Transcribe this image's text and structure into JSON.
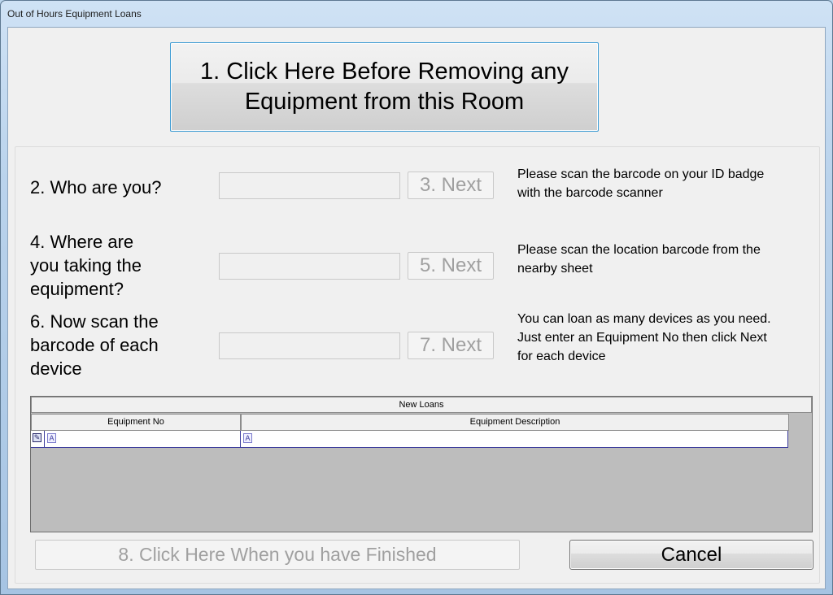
{
  "window": {
    "title": "Out of Hours Equipment Loans"
  },
  "start_button": {
    "line1": "1. Click Here Before Removing any",
    "line2": "Equipment from this Room"
  },
  "steps": [
    {
      "label_lines": [
        "2. Who are you?"
      ],
      "input_value": "",
      "next_label": "3. Next",
      "help_lines": [
        "Please scan the barcode on your ID badge",
        "with the barcode scanner"
      ]
    },
    {
      "label_lines": [
        "4. Where are",
        "you taking the",
        "equipment?"
      ],
      "input_value": "",
      "next_label": "5. Next",
      "help_lines": [
        "Please scan the location barcode from the",
        "nearby sheet"
      ]
    },
    {
      "label_lines": [
        "6. Now scan the",
        "barcode of each",
        "device"
      ],
      "input_value": "",
      "next_label": "7. Next",
      "help_lines": [
        "You can loan as many devices as you need.",
        "Just enter an Equipment No then click Next",
        "for each device"
      ]
    }
  ],
  "grid": {
    "caption": "New Loans",
    "columns": [
      "Equipment No",
      "Equipment Description"
    ],
    "new_row_icon": "edit-pencil-icon",
    "cell_type_icon": "A"
  },
  "finish_button": {
    "label": "8. Click Here When you have Finished"
  },
  "cancel_button": {
    "label": "Cancel"
  }
}
